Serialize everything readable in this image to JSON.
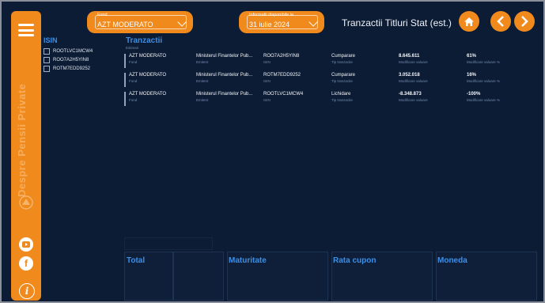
{
  "sidebar": {
    "vertical_text": "Despre Pensii Private",
    "icons": [
      "menu-icon",
      "youtube-icon",
      "facebook-icon",
      "info-icon"
    ]
  },
  "filters": {
    "fond": {
      "caption": "Fond",
      "value": "AZT MODERATO"
    },
    "date": {
      "caption": "Informatii disponibile la",
      "value": "31 iulie 2024"
    }
  },
  "header": {
    "title": "Tranzactii Titluri Stat (est.)"
  },
  "isin": {
    "title": "ISIN",
    "items": [
      "ROOTLVC1MCW4",
      "ROO7A2H5YIN8",
      "ROTM7EDD9252"
    ]
  },
  "tranzactii": {
    "title": "Tranzactii",
    "subtitle": "Estimari",
    "labels": {
      "fond": "Fond",
      "emitent": "Emitent",
      "isin": "ISIN",
      "tip": "Tip tranzactie",
      "modificare": "Modificare valoare",
      "procent": "Modificare valoare %"
    },
    "rows": [
      {
        "fond": "AZT MODERATO",
        "emitent": "Ministerul Finantelor Pub...",
        "isin": "ROO7A2H5YIN8",
        "tip": "Cumparare",
        "modificare": "8.645.611",
        "procent": "61%"
      },
      {
        "fond": "AZT MODERATO",
        "emitent": "Ministerul Finantelor Pub...",
        "isin": "ROTM7EDD9252",
        "tip": "Cumparare",
        "modificare": "3.052.018",
        "procent": "16%"
      },
      {
        "fond": "AZT MODERATO",
        "emitent": "Ministerul Finantelor Pub...",
        "isin": "ROOTLVC1MCW4",
        "tip": "Lichidare",
        "modificare": "-8.348.873",
        "procent": "-100%"
      }
    ]
  },
  "bottom": {
    "total": "Total",
    "maturitate": "Maturitate",
    "rata_cupon": "Rata cupon",
    "moneda": "Moneda"
  },
  "colors": {
    "accent": "#f08a1c",
    "background": "#0d1c35",
    "heading": "#3d8fe6"
  }
}
